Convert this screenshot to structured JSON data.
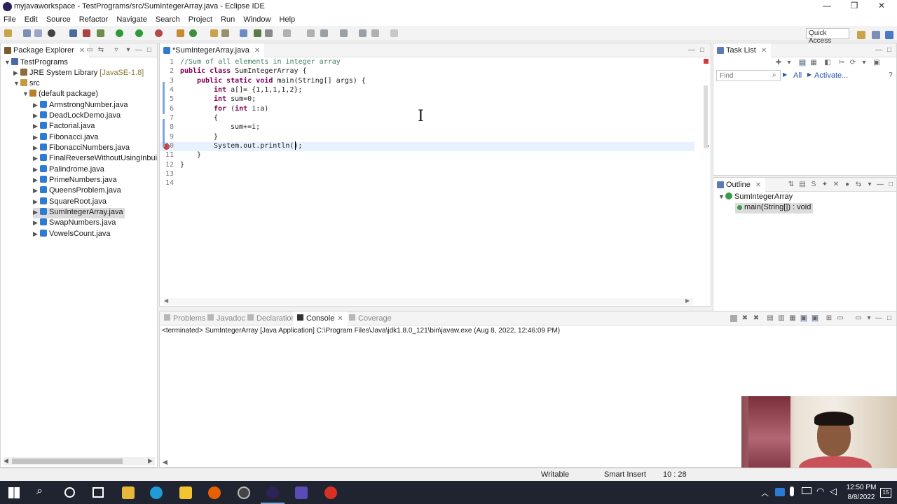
{
  "window": {
    "title": "myjavaworkspace - TestPrograms/src/SumIntegerArray.java - Eclipse IDE",
    "min_label": "—",
    "max_label": "❐",
    "close_label": "✕"
  },
  "menubar": [
    "File",
    "Edit",
    "Source",
    "Refactor",
    "Navigate",
    "Search",
    "Project",
    "Run",
    "Window",
    "Help"
  ],
  "toolbar": {
    "quick_access_label": "Quick Access"
  },
  "package_explorer": {
    "tab_label": "Package Explorer",
    "project": "TestPrograms",
    "jre_label": "JRE System Library",
    "jre_version": "[JavaSE-1.8]",
    "src_label": "src",
    "package_label": "(default package)",
    "files": [
      "ArmstrongNumber.java",
      "DeadLockDemo.java",
      "Factorial.java",
      "Fibonacci.java",
      "FibonacciNumbers.java",
      "FinalReverseWithoutUsingInbuiltFu",
      "Palindrome.java",
      "PrimeNumbers.java",
      "QueensProblem.java",
      "SquareRoot.java",
      "SumIntegerArray.java",
      "SwapNumbers.java",
      "VowelsCount.java"
    ],
    "selected_file": "SumIntegerArray.java"
  },
  "editor": {
    "tab_label": "*SumIntegerArray.java",
    "line_numbers": [
      "1",
      "2",
      "3",
      "4",
      "5",
      "6",
      "7",
      "8",
      "9",
      "10",
      "11",
      "12",
      "13",
      "14"
    ],
    "lines": {
      "l1": "//Sum of all elements in integer array",
      "l2_kw": "public class",
      "l2_rest": " SumIntegerArray {",
      "l3_kw": "public static void",
      "l3_rest": " main(String[] args) {",
      "l4_kw": "int",
      "l4_rest": " a[]= {1,1,1,1,2};",
      "l5_kw": "int",
      "l5_rest": " sum=0;",
      "l6_kw": "for",
      "l6_mid": " (",
      "l6_kw2": "int",
      "l6_rest": " i:a)",
      "l7": "{",
      "l8": "sum+=i;",
      "l9": "}",
      "l10": "System.out.println();",
      "l11": "}",
      "l12": "}"
    }
  },
  "task_list": {
    "tab_label": "Task List",
    "find_placeholder": "Find",
    "all_label": "All",
    "activate_label": "Activate..."
  },
  "outline": {
    "tab_label": "Outline",
    "class_name": "SumIntegerArray",
    "method_label": "main(String[]) : void"
  },
  "bottom_panel": {
    "tabs": [
      "Problems",
      "Javadoc",
      "Declaration",
      "Console",
      "Coverage"
    ],
    "active_tab": "Console",
    "console_text": "<terminated> SumIntegerArray [Java Application] C:\\Program Files\\Java\\jdk1.8.0_121\\bin\\javaw.exe (Aug 8, 2022, 12:46:09 PM)"
  },
  "statusbar": {
    "writable": "Writable",
    "insert_mode": "Smart Insert",
    "position": "10 : 28"
  },
  "taskbar": {
    "time": "12:50 PM",
    "date": "8/8/2022",
    "notification_count": "15"
  },
  "colors": {
    "keyword": "#7f0055",
    "comment": "#3f7f5f",
    "field": "#0000c0",
    "taskbar": "#1f2430"
  }
}
